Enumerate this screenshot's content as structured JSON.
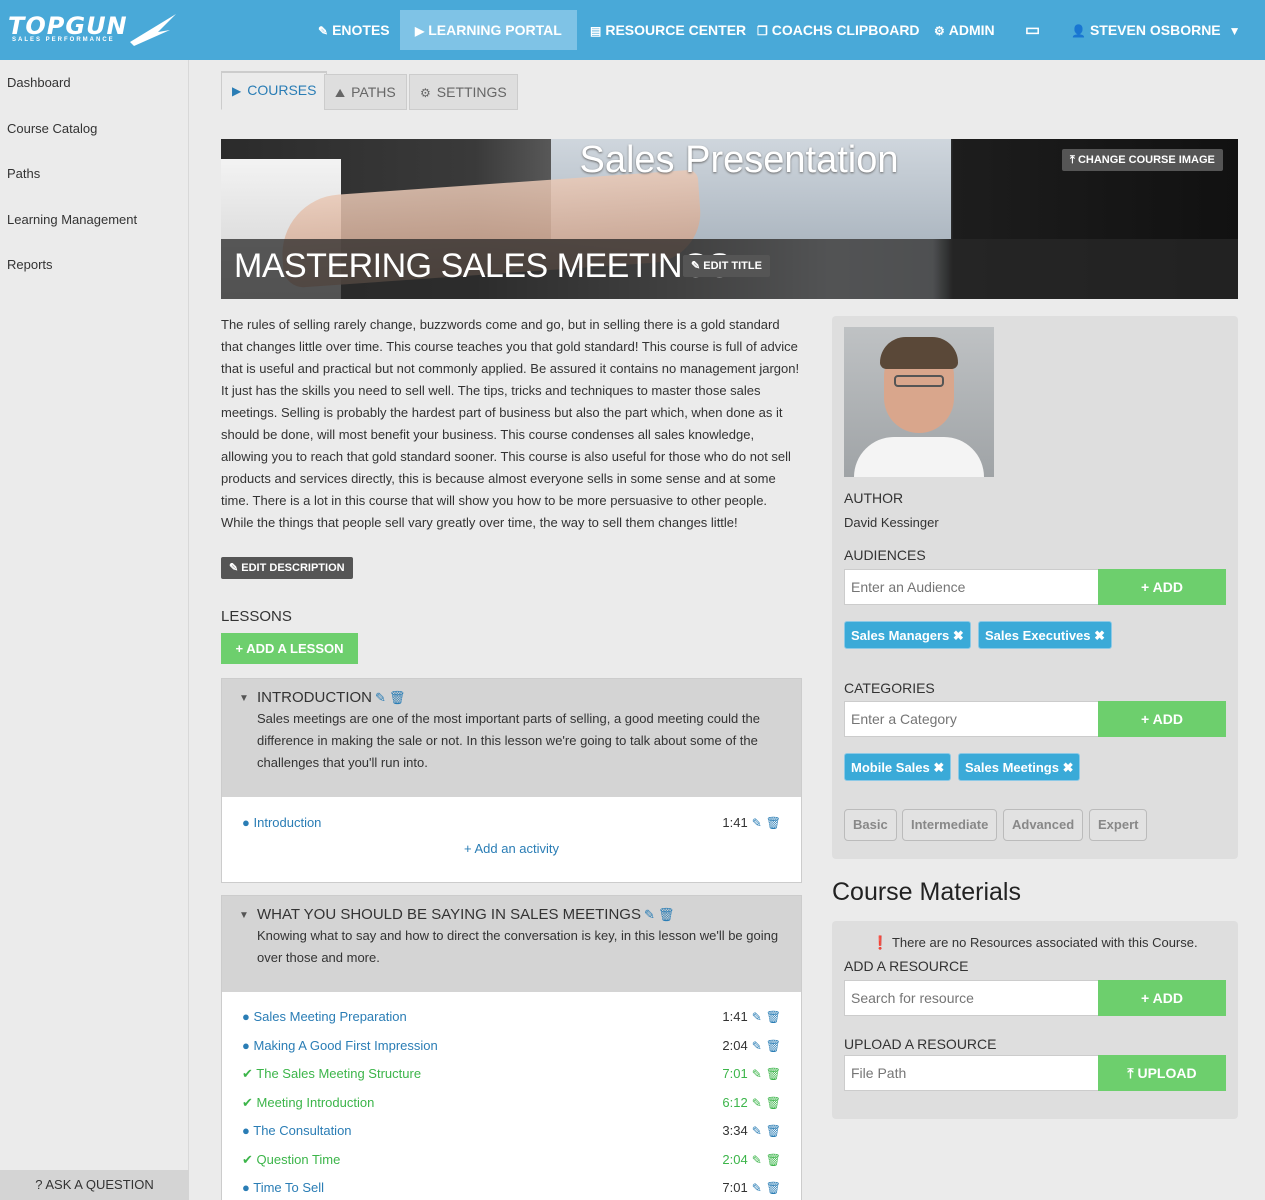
{
  "brand": {
    "logo_text": "TOPGUN",
    "logo_sub": "SALES PERFORMANCE"
  },
  "nav": {
    "enotes": "ENOTES",
    "learning_portal": "LEARNING PORTAL",
    "resource_center": "RESOURCE CENTER",
    "coachs_clipboard": "COACHS CLIPBOARD",
    "admin": "ADMIN",
    "user": "STEVEN OSBORNE"
  },
  "sidebar": {
    "items": [
      {
        "label": "Dashboard"
      },
      {
        "label": "Course Catalog"
      },
      {
        "label": "Paths"
      },
      {
        "label": "Learning Management"
      },
      {
        "label": "Reports"
      }
    ],
    "ask": "ASK A QUESTION"
  },
  "tabs": [
    {
      "label": "COURSES"
    },
    {
      "label": "PATHS"
    },
    {
      "label": "SETTINGS"
    }
  ],
  "course": {
    "banner_text": "Sales Presentation",
    "title": "MASTERING SALES MEETINGS",
    "change_image": "CHANGE COURSE IMAGE",
    "edit_title": "EDIT TITLE",
    "description": "The rules of selling rarely change, buzzwords come and go, but in selling there is a gold standard that changes little over time. This course teaches you that gold standard! This course is full of advice that is useful and practical but not commonly applied. Be assured it contains no management jargon! It just has the skills you need to sell well. The tips, tricks and techniques to master those sales meetings. Selling is probably the hardest part of business but also the part which, when done as it should be done, will most benefit your business. This course condenses all sales knowledge, allowing you to reach that gold standard sooner. This course is also useful for those who do not sell products and services directly, this is because almost everyone sells in some sense and at some time. There is a lot in this course that will show you how to be more persuasive to other people. While the things that people sell vary greatly over time, the way to sell them changes little!",
    "edit_description": "EDIT DESCRIPTION"
  },
  "lessons": {
    "heading": "LESSONS",
    "add_lesson": "ADD A LESSON",
    "items": [
      {
        "title": "INTRODUCTION",
        "description": "Sales meetings are one of the most important parts of selling, a good meeting could the difference in making the sale or not. In this lesson we're going to talk about some of the challenges that you'll run into.",
        "activities": [
          {
            "name": "Introduction",
            "duration": "1:41",
            "completed": false
          }
        ],
        "add_activity": "Add an activity"
      },
      {
        "title": "WHAT YOU SHOULD BE SAYING IN SALES MEETINGS",
        "description": "Knowing what to say and how to direct the conversation is key, in this lesson we'll be going over those and more.",
        "activities": [
          {
            "name": "Sales Meeting Preparation",
            "duration": "1:41",
            "completed": false
          },
          {
            "name": "Making A Good First Impression",
            "duration": "2:04",
            "completed": false
          },
          {
            "name": "The Sales Meeting Structure",
            "duration": "7:01",
            "completed": true
          },
          {
            "name": "Meeting Introduction",
            "duration": "6:12",
            "completed": true
          },
          {
            "name": "The Consultation",
            "duration": "3:34",
            "completed": false
          },
          {
            "name": "Question Time",
            "duration": "2:04",
            "completed": true
          },
          {
            "name": "Time To Sell",
            "duration": "7:01",
            "completed": false
          }
        ]
      }
    ]
  },
  "author": {
    "label": "AUTHOR",
    "name": "David Kessinger"
  },
  "audiences": {
    "label": "AUDIENCES",
    "placeholder": "Enter an Audience",
    "add": "ADD",
    "tags": [
      "Sales Managers",
      "Sales Executives"
    ]
  },
  "categories": {
    "label": "CATEGORIES",
    "placeholder": "Enter a Category",
    "add": "ADD",
    "tags": [
      "Mobile Sales",
      "Sales Meetings"
    ]
  },
  "levels": [
    "Basic",
    "Intermediate",
    "Advanced",
    "Expert"
  ],
  "materials": {
    "title": "Course Materials",
    "none_notice": "There are no Resources associated with this Course.",
    "add_label": "ADD A RESOURCE",
    "search_placeholder": "Search for resource",
    "add": "ADD",
    "upload_label": "UPLOAD A RESOURCE",
    "file_placeholder": "File Path",
    "upload": "UPLOAD"
  },
  "colors": {
    "brand": "#49a9d8",
    "accent": "#2a7db5",
    "success": "#6dcf6d",
    "tag": "#3aaad8"
  }
}
